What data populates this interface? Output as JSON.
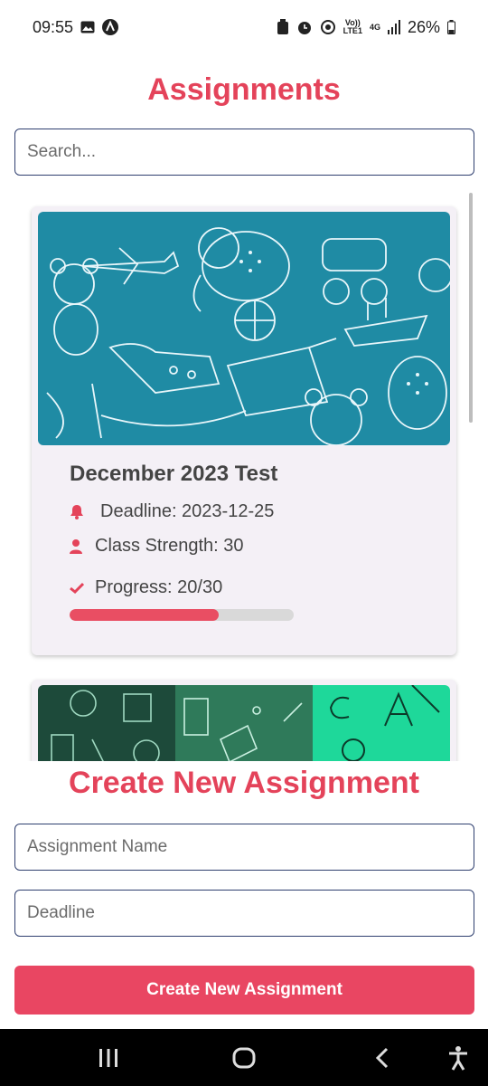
{
  "status_bar": {
    "time": "09:55",
    "net_top": "Vo))",
    "net_bottom": "LTE1",
    "signal_label": "4G",
    "battery": "26%"
  },
  "header": {
    "title": "Assignments"
  },
  "search": {
    "placeholder": "Search...",
    "value": ""
  },
  "assignments": [
    {
      "title": "December 2023 Test",
      "deadline": "Deadline: 2023-12-25",
      "class_strength": "Class Strength: 30",
      "progress_label": "Progress: 20/30",
      "progress_fraction": 0.667
    }
  ],
  "create_form": {
    "title": "Create New Assignment",
    "name_placeholder": "Assignment Name",
    "deadline_placeholder": "Deadline",
    "submit_label": "Create New Assignment"
  },
  "colors": {
    "accent": "#e4435a",
    "button": "#e94662",
    "card_bg": "#f4f0f6",
    "input_border": "#2f3f6f",
    "card1_image": "#1f8ba4",
    "card2_panels": [
      "#1d4a3a",
      "#2f7a5a",
      "#1ed89a"
    ]
  },
  "icons": {
    "deadline": "bell-icon",
    "strength": "user-icon",
    "progress": "check-icon"
  }
}
